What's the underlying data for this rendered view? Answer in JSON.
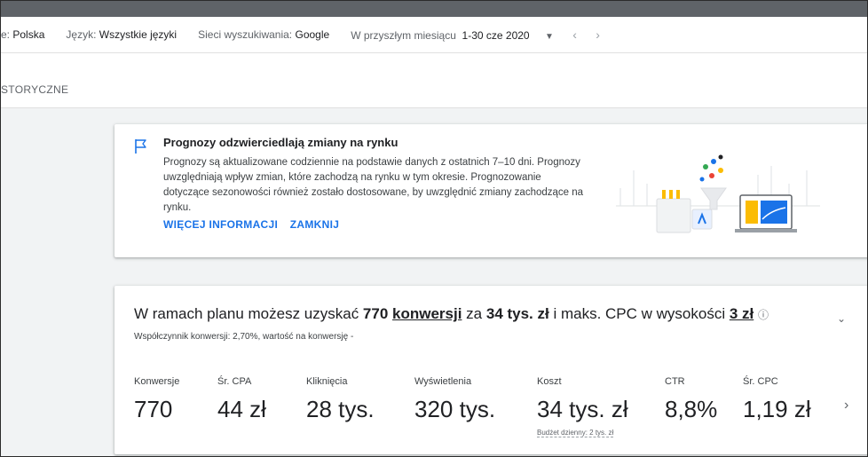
{
  "filters": {
    "location_label": "e:",
    "location_value": "Polska",
    "language_label": "Język:",
    "language_value": "Wszystkie języki",
    "network_label": "Sieci wyszukiwania:",
    "network_value": "Google",
    "period_label": "W przyszłym miesiącu",
    "period_value": "1-30 cze 2020",
    "icons": {
      "dropdown": "caret-down-icon",
      "prev": "chevron-left-icon",
      "next": "chevron-right-icon"
    }
  },
  "tabs": {
    "historic": "STORYCZNE"
  },
  "notice": {
    "title": "Prognozy odzwierciedlają zmiany na rynku",
    "body": "Prognozy są aktualizowane codziennie na podstawie danych z ostatnich 7–10 dni. Prognozy uwzględniają wpływ zmian, które zachodzą na rynku w tym okresie. Prognozowanie dotyczące sezonowości również zostało dostosowane, by uwzględnić zmiany zachodzące na rynku.",
    "more_link": "WIĘCEJ INFORMACJI",
    "close_link": "ZAMKNIJ",
    "icon": "flag-icon",
    "accent": "#1a73e8"
  },
  "plan": {
    "text_1": "W ramach planu możesz uzyskać ",
    "conversions": "770",
    "conversions_word": "konwersji",
    "text_2": " za ",
    "cost": "34 tys. zł",
    "text_3": " i maks. CPC w wysokości ",
    "max_cpc": "3 zł",
    "help_icon": "?",
    "subtitle": "Współczynnik konwersji: 2,70%, wartość na konwersję -",
    "metrics": [
      {
        "label": "Konwersje",
        "value": "770"
      },
      {
        "label": "Śr. CPA",
        "value": "44 zł"
      },
      {
        "label": "Kliknięcia",
        "value": "28 tys."
      },
      {
        "label": "Wyświetlenia",
        "value": "320 tys."
      },
      {
        "label": "Koszt",
        "value": "34 tys. zł",
        "note": "Budżet dzienny: 2 tys. zł"
      },
      {
        "label": "CTR",
        "value": "8,8%"
      },
      {
        "label": "Śr. CPC",
        "value": "1,19 zł"
      }
    ]
  }
}
